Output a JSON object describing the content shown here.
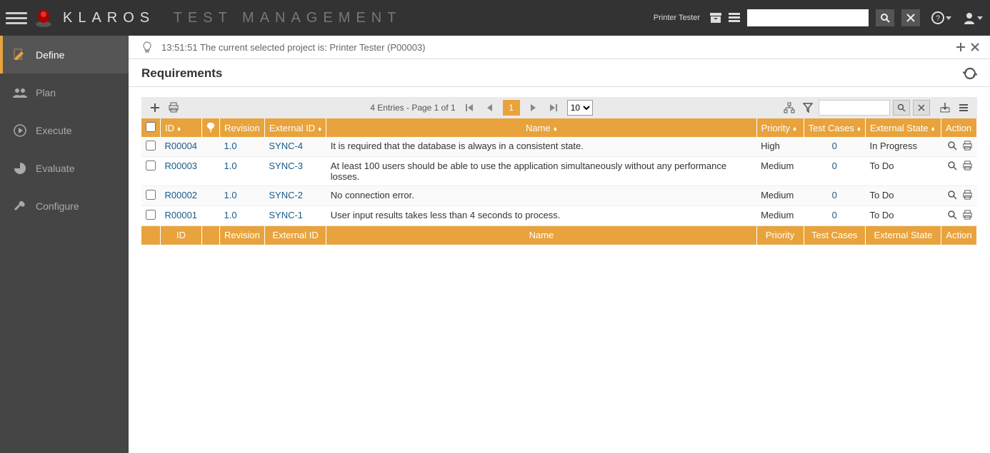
{
  "brand": {
    "main": "KLAROS",
    "sub": "TEST MANAGEMENT"
  },
  "header": {
    "project": "Printer Tester"
  },
  "sidebar": {
    "items": [
      {
        "label": "Define",
        "active": true
      },
      {
        "label": "Plan",
        "active": false
      },
      {
        "label": "Execute",
        "active": false
      },
      {
        "label": "Evaluate",
        "active": false
      },
      {
        "label": "Configure",
        "active": false
      }
    ]
  },
  "notice": {
    "text": "13:51:51 The current selected project is: Printer Tester (P00003)"
  },
  "page": {
    "title": "Requirements"
  },
  "toolbar": {
    "entries_text": "4 Entries - Page 1 of 1",
    "page_num": "1",
    "page_size": "10"
  },
  "table": {
    "headers": {
      "id": "ID",
      "revision": "Revision",
      "external_id": "External ID",
      "name": "Name",
      "priority": "Priority",
      "test_cases": "Test Cases",
      "external_state": "External State",
      "action": "Action"
    },
    "rows": [
      {
        "id": "R00004",
        "revision": "1.0",
        "external_id": "SYNC-4",
        "name": "It is required that the database is always in a consistent state.",
        "priority": "High",
        "test_cases": "0",
        "external_state": "In Progress"
      },
      {
        "id": "R00003",
        "revision": "1.0",
        "external_id": "SYNC-3",
        "name": "At least 100 users should be able to use the application simultaneously without any performance losses.",
        "priority": "Medium",
        "test_cases": "0",
        "external_state": "To Do"
      },
      {
        "id": "R00002",
        "revision": "1.0",
        "external_id": "SYNC-2",
        "name": "No connection error.",
        "priority": "Medium",
        "test_cases": "0",
        "external_state": "To Do"
      },
      {
        "id": "R00001",
        "revision": "1.0",
        "external_id": "SYNC-1",
        "name": "User input results takes less than 4 seconds to process.",
        "priority": "Medium",
        "test_cases": "0",
        "external_state": "To Do"
      }
    ]
  }
}
